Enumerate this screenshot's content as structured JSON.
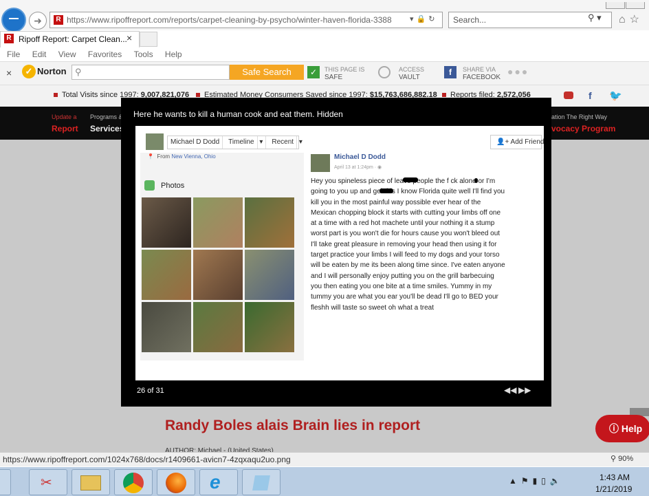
{
  "browser": {
    "url": "https://www.ripoffreport.com/reports/carpet-cleaning-by-psycho/winter-haven-florida-3388",
    "search_placeholder": "Search...",
    "tab_title": "Ripoff Report: Carpet Clean...",
    "tab_close": "×",
    "menu": [
      "File",
      "Edit",
      "View",
      "Favorites",
      "Tools",
      "Help"
    ],
    "status_url": "https://www.ripoffreport.com/1024x768/docs/r1409661-avicn7-4zqxaqu2uo.png",
    "zoom": "90%"
  },
  "norton": {
    "close": "×",
    "brand": "Norton",
    "search_button": "Safe Search",
    "this_page_label": "THIS PAGE IS",
    "this_page_value": "SAFE",
    "access_label": "ACCESS",
    "access_value": "VAULT",
    "share_label": "SHARE VIA",
    "share_value": "FACEBOOK",
    "more": "●●●"
  },
  "site": {
    "stats": [
      {
        "label": "Total Visits since 1997:",
        "value": "9,007,821,076"
      },
      {
        "label": "Estimated Money Consumers Saved since 1997:",
        "value": "$15,763,686,882.18"
      },
      {
        "label": "Reports filed:",
        "value": "2,572,056"
      }
    ],
    "nav": [
      {
        "small": "Update a",
        "big": "Report"
      },
      {
        "small": "Programs &",
        "big": "Services"
      },
      {
        "small": "ation The Right Way",
        "big": "vocacy Program"
      }
    ],
    "report_title": "Randy Boles alais Brain lies in report",
    "author_line": "AUTHOR: Michael - (United States)",
    "help_label": "Help"
  },
  "lightbox": {
    "caption": "Here he wants to kill a human cook and eat them. Hidden",
    "counter": "26 of 31",
    "prev": "◀◀",
    "next": "▶▶"
  },
  "fb": {
    "profile_name": "Michael D Dodd",
    "tab_timeline": "Timeline",
    "tab_recent": "Recent",
    "add_friend": "Add Friend",
    "from_label": "From",
    "from_place": "New Vienna, Ohio",
    "photos_label": "Photos",
    "post_author": "Michael D Dodd",
    "post_date": "April 13 at 1:24pm · ",
    "post_text": "Hey you spineless piece of        leave people the f ck alone or I'm going to        you up and gebthis I know Florida quite well I'll find you kill you in the most painful way possible ever hear of the Mexican chopping block it starts with cutting your limbs off one at a time with a red hot machete until your nothing it a stump worst part is you won't die for hours cause you won't bleed out I'll take great pleasure in removing your head then using it for target practice your limbs I will feed to my dogs and your torso will be eaten by me its been along time since. I've eaten anyone and I will personally enjoy putting you on the grill barbecuing you then eating you one bite at a time smiles. Yummy in my tummy you are what you ear you'll be dead I'll go to BED your fleshh will taste so sweet oh what a treat"
  },
  "taskbar": {
    "time": "1:43 AM",
    "date": "1/21/2019"
  },
  "colors": {
    "accent": "#b02020",
    "norton_orange": "#f5a623",
    "ie_blue": "#1e73c9",
    "facebook_blue": "#3b5998"
  }
}
